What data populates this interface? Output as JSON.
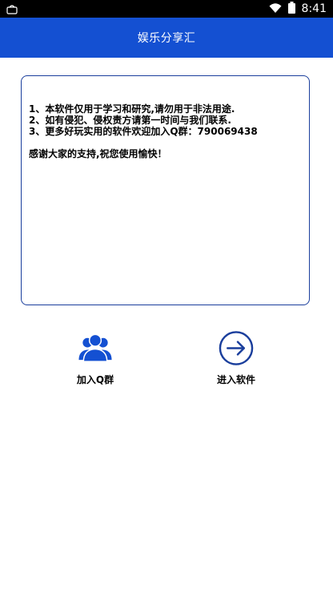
{
  "status_bar": {
    "time": "8:41"
  },
  "app_bar": {
    "title": "娱乐分享汇"
  },
  "notice": {
    "lines": [
      "1、本软件仅用于学习和研究,请勿用于非法用途.",
      "2、如有侵犯、侵权责方请第一时间与我们联系.",
      "3、更多好玩实用的软件欢迎加入Q群：790069438"
    ],
    "thanks": "感谢大家的支持,祝您使用愉快！"
  },
  "actions": {
    "join_group": {
      "label": "加入Q群",
      "icon": "group-icon"
    },
    "enter_app": {
      "label": "进入软件",
      "icon": "arrow-right-circle-icon"
    }
  },
  "colors": {
    "primary": "#1450d2",
    "border": "#1a3e9c"
  }
}
